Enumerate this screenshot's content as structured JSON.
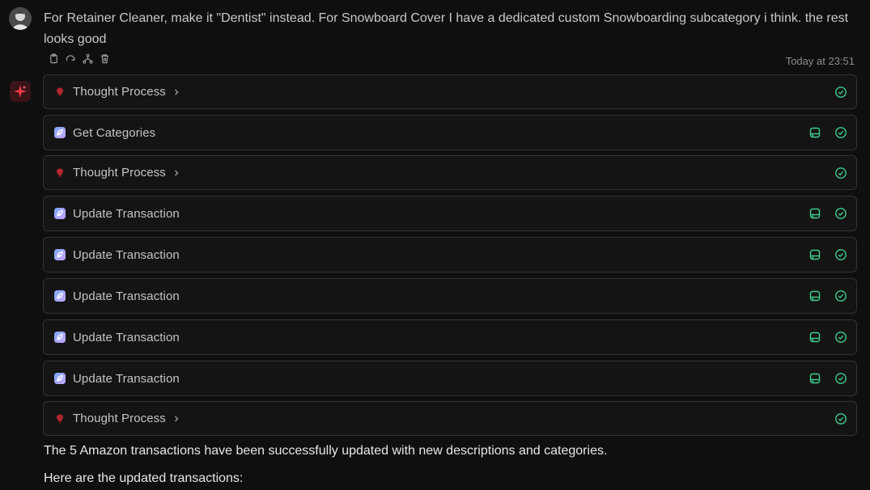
{
  "user_message": {
    "text": "For Retainer Cleaner, make it \"Dentist\" instead. For Snowboard Cover I have a dedicated custom Snowboarding subcategory i think. the rest looks good",
    "timestamp": "Today at 23:51",
    "actions": [
      "copy-icon",
      "retry-icon",
      "branch-icon",
      "trash-icon"
    ]
  },
  "steps": [
    {
      "label": "Thought Process",
      "kind": "thought",
      "expandable": true,
      "storage": false
    },
    {
      "label": "Get Categories",
      "kind": "tool",
      "expandable": false,
      "storage": true
    },
    {
      "label": "Thought Process",
      "kind": "thought",
      "expandable": true,
      "storage": false
    },
    {
      "label": "Update Transaction",
      "kind": "tool",
      "expandable": false,
      "storage": true
    },
    {
      "label": "Update Transaction",
      "kind": "tool",
      "expandable": false,
      "storage": true
    },
    {
      "label": "Update Transaction",
      "kind": "tool",
      "expandable": false,
      "storage": true
    },
    {
      "label": "Update Transaction",
      "kind": "tool",
      "expandable": false,
      "storage": true
    },
    {
      "label": "Update Transaction",
      "kind": "tool",
      "expandable": false,
      "storage": true
    },
    {
      "label": "Thought Process",
      "kind": "thought",
      "expandable": true,
      "storage": false
    }
  ],
  "assistant_reply": {
    "line1": "The 5 Amazon transactions have been successfully updated with new descriptions and categories.",
    "line2": "Here are the updated transactions:"
  },
  "colors": {
    "success": "#3ecf8e",
    "thought_icon": "#b3262e",
    "tool_icon_start": "#7aa7ff",
    "tool_icon_end": "#c9a7ff"
  }
}
